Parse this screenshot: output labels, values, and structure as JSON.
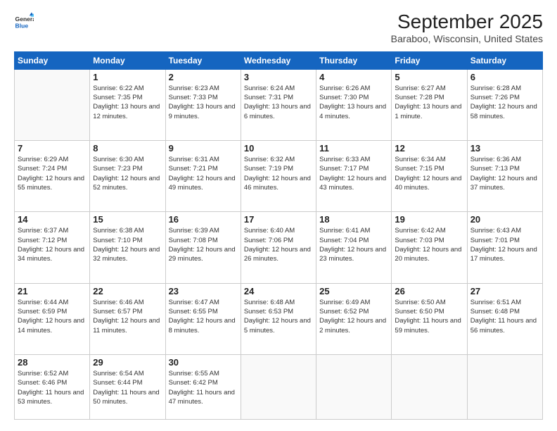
{
  "header": {
    "logo": {
      "general": "General",
      "blue": "Blue"
    },
    "title": "September 2025",
    "subtitle": "Baraboo, Wisconsin, United States"
  },
  "calendar": {
    "days_of_week": [
      "Sunday",
      "Monday",
      "Tuesday",
      "Wednesday",
      "Thursday",
      "Friday",
      "Saturday"
    ],
    "weeks": [
      [
        {
          "num": "",
          "sunrise": "",
          "sunset": "",
          "daylight": "",
          "empty": true
        },
        {
          "num": "1",
          "sunrise": "Sunrise: 6:22 AM",
          "sunset": "Sunset: 7:35 PM",
          "daylight": "Daylight: 13 hours and 12 minutes.",
          "empty": false
        },
        {
          "num": "2",
          "sunrise": "Sunrise: 6:23 AM",
          "sunset": "Sunset: 7:33 PM",
          "daylight": "Daylight: 13 hours and 9 minutes.",
          "empty": false
        },
        {
          "num": "3",
          "sunrise": "Sunrise: 6:24 AM",
          "sunset": "Sunset: 7:31 PM",
          "daylight": "Daylight: 13 hours and 6 minutes.",
          "empty": false
        },
        {
          "num": "4",
          "sunrise": "Sunrise: 6:26 AM",
          "sunset": "Sunset: 7:30 PM",
          "daylight": "Daylight: 13 hours and 4 minutes.",
          "empty": false
        },
        {
          "num": "5",
          "sunrise": "Sunrise: 6:27 AM",
          "sunset": "Sunset: 7:28 PM",
          "daylight": "Daylight: 13 hours and 1 minute.",
          "empty": false
        },
        {
          "num": "6",
          "sunrise": "Sunrise: 6:28 AM",
          "sunset": "Sunset: 7:26 PM",
          "daylight": "Daylight: 12 hours and 58 minutes.",
          "empty": false
        }
      ],
      [
        {
          "num": "7",
          "sunrise": "Sunrise: 6:29 AM",
          "sunset": "Sunset: 7:24 PM",
          "daylight": "Daylight: 12 hours and 55 minutes.",
          "empty": false
        },
        {
          "num": "8",
          "sunrise": "Sunrise: 6:30 AM",
          "sunset": "Sunset: 7:23 PM",
          "daylight": "Daylight: 12 hours and 52 minutes.",
          "empty": false
        },
        {
          "num": "9",
          "sunrise": "Sunrise: 6:31 AM",
          "sunset": "Sunset: 7:21 PM",
          "daylight": "Daylight: 12 hours and 49 minutes.",
          "empty": false
        },
        {
          "num": "10",
          "sunrise": "Sunrise: 6:32 AM",
          "sunset": "Sunset: 7:19 PM",
          "daylight": "Daylight: 12 hours and 46 minutes.",
          "empty": false
        },
        {
          "num": "11",
          "sunrise": "Sunrise: 6:33 AM",
          "sunset": "Sunset: 7:17 PM",
          "daylight": "Daylight: 12 hours and 43 minutes.",
          "empty": false
        },
        {
          "num": "12",
          "sunrise": "Sunrise: 6:34 AM",
          "sunset": "Sunset: 7:15 PM",
          "daylight": "Daylight: 12 hours and 40 minutes.",
          "empty": false
        },
        {
          "num": "13",
          "sunrise": "Sunrise: 6:36 AM",
          "sunset": "Sunset: 7:13 PM",
          "daylight": "Daylight: 12 hours and 37 minutes.",
          "empty": false
        }
      ],
      [
        {
          "num": "14",
          "sunrise": "Sunrise: 6:37 AM",
          "sunset": "Sunset: 7:12 PM",
          "daylight": "Daylight: 12 hours and 34 minutes.",
          "empty": false
        },
        {
          "num": "15",
          "sunrise": "Sunrise: 6:38 AM",
          "sunset": "Sunset: 7:10 PM",
          "daylight": "Daylight: 12 hours and 32 minutes.",
          "empty": false
        },
        {
          "num": "16",
          "sunrise": "Sunrise: 6:39 AM",
          "sunset": "Sunset: 7:08 PM",
          "daylight": "Daylight: 12 hours and 29 minutes.",
          "empty": false
        },
        {
          "num": "17",
          "sunrise": "Sunrise: 6:40 AM",
          "sunset": "Sunset: 7:06 PM",
          "daylight": "Daylight: 12 hours and 26 minutes.",
          "empty": false
        },
        {
          "num": "18",
          "sunrise": "Sunrise: 6:41 AM",
          "sunset": "Sunset: 7:04 PM",
          "daylight": "Daylight: 12 hours and 23 minutes.",
          "empty": false
        },
        {
          "num": "19",
          "sunrise": "Sunrise: 6:42 AM",
          "sunset": "Sunset: 7:03 PM",
          "daylight": "Daylight: 12 hours and 20 minutes.",
          "empty": false
        },
        {
          "num": "20",
          "sunrise": "Sunrise: 6:43 AM",
          "sunset": "Sunset: 7:01 PM",
          "daylight": "Daylight: 12 hours and 17 minutes.",
          "empty": false
        }
      ],
      [
        {
          "num": "21",
          "sunrise": "Sunrise: 6:44 AM",
          "sunset": "Sunset: 6:59 PM",
          "daylight": "Daylight: 12 hours and 14 minutes.",
          "empty": false
        },
        {
          "num": "22",
          "sunrise": "Sunrise: 6:46 AM",
          "sunset": "Sunset: 6:57 PM",
          "daylight": "Daylight: 12 hours and 11 minutes.",
          "empty": false
        },
        {
          "num": "23",
          "sunrise": "Sunrise: 6:47 AM",
          "sunset": "Sunset: 6:55 PM",
          "daylight": "Daylight: 12 hours and 8 minutes.",
          "empty": false
        },
        {
          "num": "24",
          "sunrise": "Sunrise: 6:48 AM",
          "sunset": "Sunset: 6:53 PM",
          "daylight": "Daylight: 12 hours and 5 minutes.",
          "empty": false
        },
        {
          "num": "25",
          "sunrise": "Sunrise: 6:49 AM",
          "sunset": "Sunset: 6:52 PM",
          "daylight": "Daylight: 12 hours and 2 minutes.",
          "empty": false
        },
        {
          "num": "26",
          "sunrise": "Sunrise: 6:50 AM",
          "sunset": "Sunset: 6:50 PM",
          "daylight": "Daylight: 11 hours and 59 minutes.",
          "empty": false
        },
        {
          "num": "27",
          "sunrise": "Sunrise: 6:51 AM",
          "sunset": "Sunset: 6:48 PM",
          "daylight": "Daylight: 11 hours and 56 minutes.",
          "empty": false
        }
      ],
      [
        {
          "num": "28",
          "sunrise": "Sunrise: 6:52 AM",
          "sunset": "Sunset: 6:46 PM",
          "daylight": "Daylight: 11 hours and 53 minutes.",
          "empty": false
        },
        {
          "num": "29",
          "sunrise": "Sunrise: 6:54 AM",
          "sunset": "Sunset: 6:44 PM",
          "daylight": "Daylight: 11 hours and 50 minutes.",
          "empty": false
        },
        {
          "num": "30",
          "sunrise": "Sunrise: 6:55 AM",
          "sunset": "Sunset: 6:42 PM",
          "daylight": "Daylight: 11 hours and 47 minutes.",
          "empty": false
        },
        {
          "num": "",
          "sunrise": "",
          "sunset": "",
          "daylight": "",
          "empty": true
        },
        {
          "num": "",
          "sunrise": "",
          "sunset": "",
          "daylight": "",
          "empty": true
        },
        {
          "num": "",
          "sunrise": "",
          "sunset": "",
          "daylight": "",
          "empty": true
        },
        {
          "num": "",
          "sunrise": "",
          "sunset": "",
          "daylight": "",
          "empty": true
        }
      ]
    ]
  }
}
